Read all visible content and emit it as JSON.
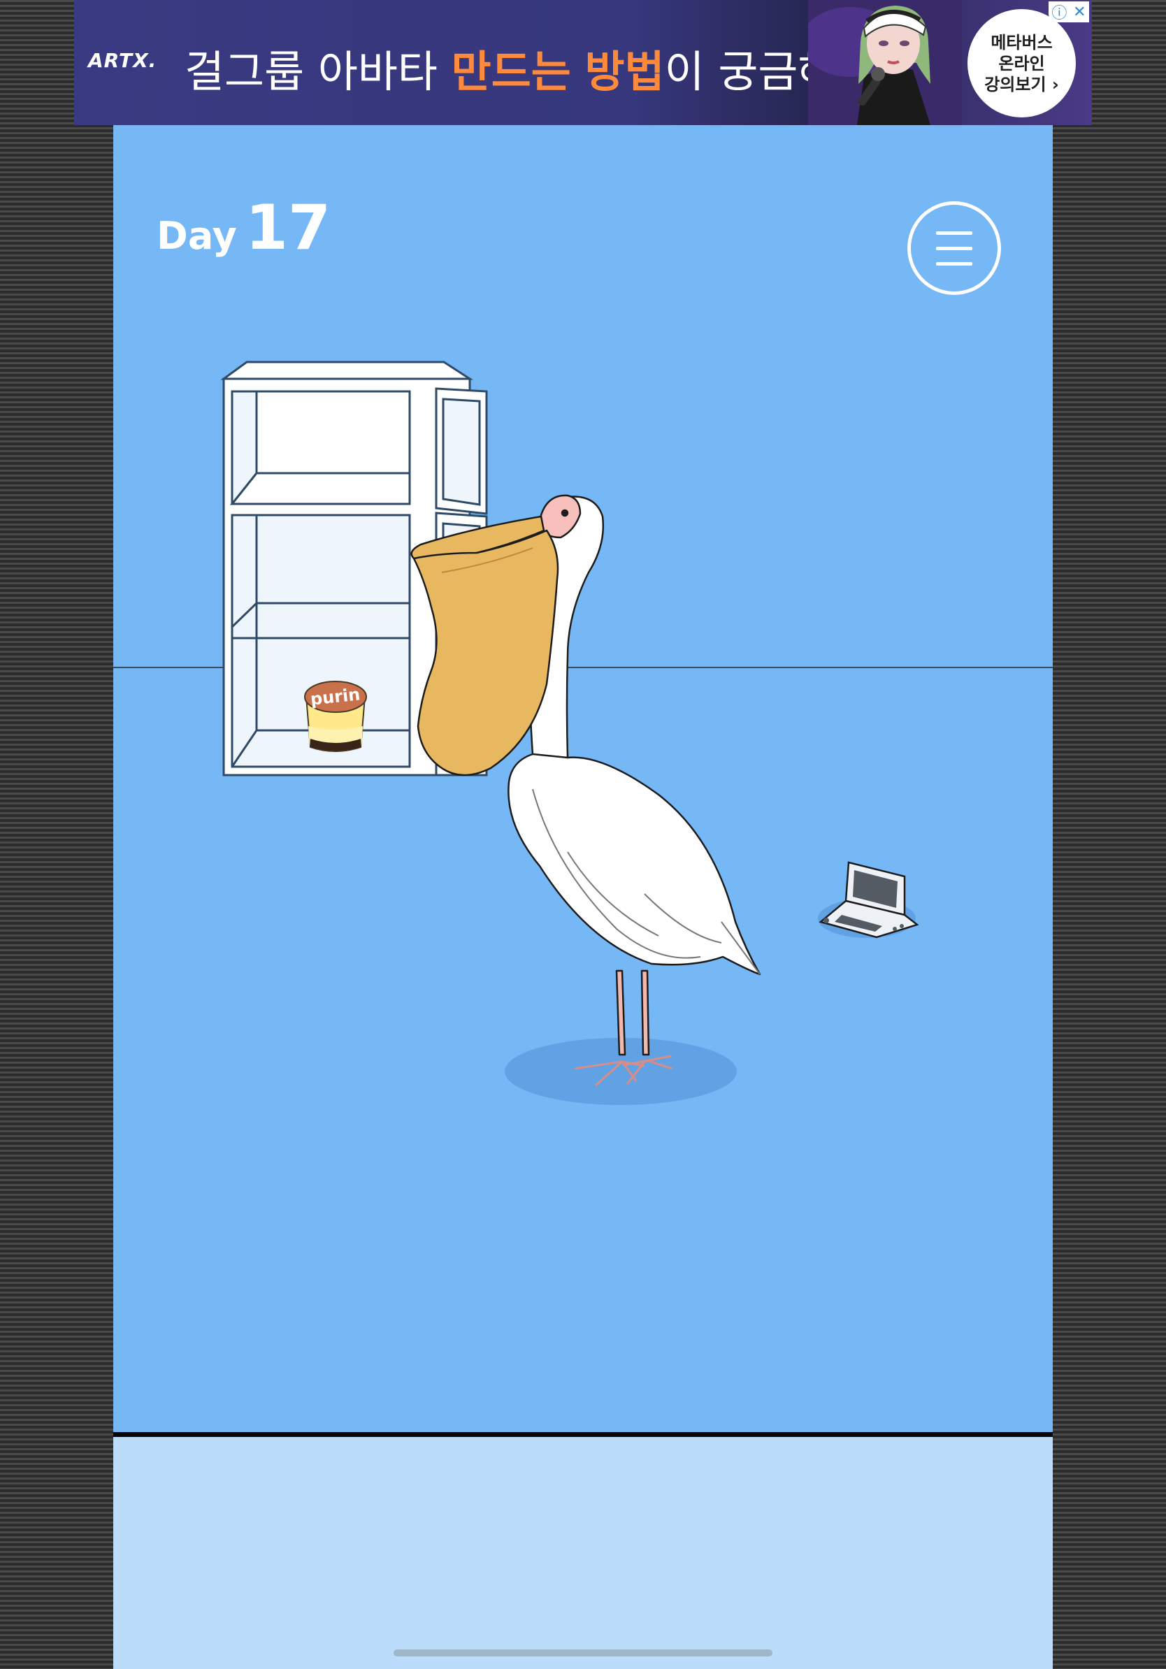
{
  "ad": {
    "brand_logo": "ARTX.",
    "headline_prefix": "걸그룹 아바타 ",
    "headline_highlight_1": "만드는",
    "headline_space": " ",
    "headline_highlight_2": "방법",
    "headline_suffix": "이 궁금해?",
    "cta_line_1": "메타버스",
    "cta_line_2": "온라인",
    "cta_line_3": "강의보기 ›",
    "info_icon": "ⓘ",
    "close_icon": "✕"
  },
  "game": {
    "day_word": "Day",
    "day_number": "17",
    "menu_icon": "hamburger-icon",
    "pudding_label": "purin",
    "items": [
      "refrigerator",
      "purin-pudding",
      "pelican",
      "handheld-game-console"
    ]
  },
  "colors": {
    "sky": "#76b8f6",
    "floor_lower": "#bbdcfb",
    "pelican_pouch": "#e8b861",
    "pudding_lid": "#c8714a",
    "accent_orange": "#ff8a3c"
  }
}
